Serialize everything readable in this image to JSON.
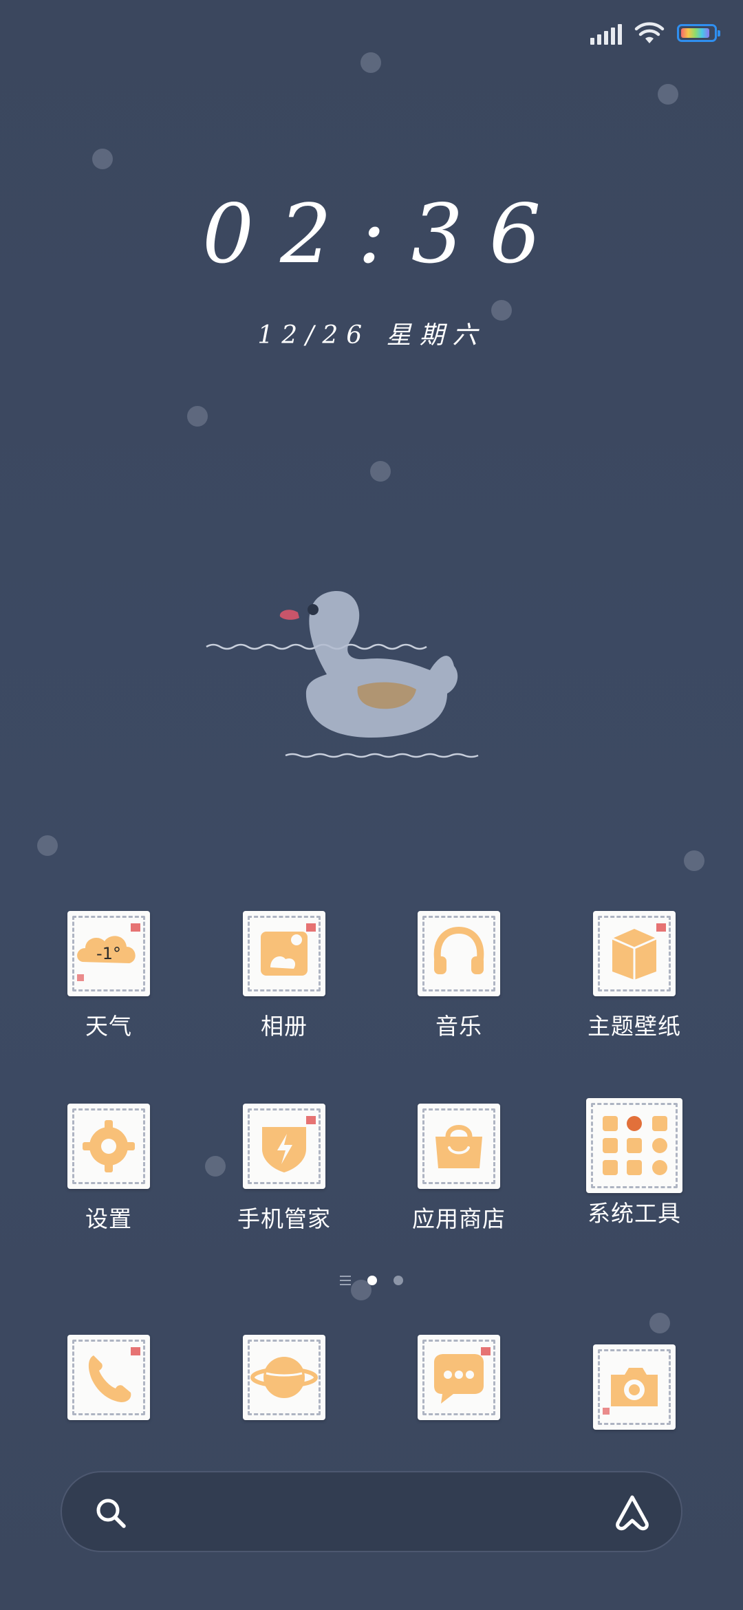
{
  "status_bar": {
    "signal_icon": "cellular-signal-icon",
    "wifi_icon": "wifi-icon",
    "battery_icon": "battery-icon",
    "battery_level": 0.9
  },
  "lockscreen": {
    "time": "02:36",
    "date": "12/26 星期六"
  },
  "apps": [
    {
      "label": "天气",
      "icon": "weather-icon",
      "badge": "-1°"
    },
    {
      "label": "相册",
      "icon": "gallery-icon"
    },
    {
      "label": "音乐",
      "icon": "music-icon"
    },
    {
      "label": "主题壁纸",
      "icon": "themes-icon"
    },
    {
      "label": "设置",
      "icon": "settings-icon"
    },
    {
      "label": "手机管家",
      "icon": "security-icon"
    },
    {
      "label": "应用商店",
      "icon": "app-store-icon"
    },
    {
      "label": "系统工具",
      "icon": "system-tools-folder-icon"
    }
  ],
  "dock": [
    {
      "icon": "phone-icon"
    },
    {
      "icon": "browser-icon"
    },
    {
      "icon": "messages-icon"
    },
    {
      "icon": "camera-icon"
    }
  ],
  "page_indicator": {
    "pages": 2,
    "active": 1
  },
  "search": {
    "search_icon": "search-icon",
    "assistant_icon": "assistant-icon"
  },
  "colors": {
    "background": "#3c4860",
    "icon_fill": "#f8c078",
    "icon_tile": "#fbfbfa"
  }
}
